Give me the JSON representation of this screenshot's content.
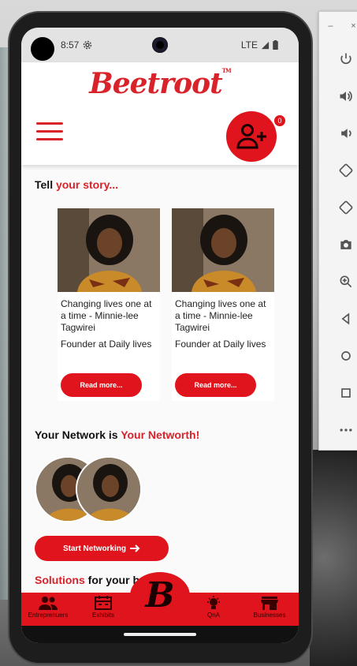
{
  "status_bar": {
    "time": "8:57",
    "network": "LTE"
  },
  "app": {
    "logo_text": "Beetroot",
    "trademark": "TM",
    "invite_badge_count": "0"
  },
  "story_section": {
    "title_plain": "Tell ",
    "title_accent": "your story...",
    "cards": [
      {
        "headline": "Changing lives one at a time - Minnie-lee Tagwirei",
        "role": "Founder at Daily lives",
        "button_label": "Read more..."
      },
      {
        "headline": "Changing lives one at a time - Minnie-lee Tagwirei",
        "role": "Founder at Daily lives",
        "button_label": "Read more..."
      }
    ]
  },
  "network_section": {
    "title_plain": "Your Network is ",
    "title_accent": "Your Networth!",
    "button_label": "Start Networking"
  },
  "solutions_section": {
    "title_accent": "Solutions",
    "title_plain": " for your b"
  },
  "bottom_nav": {
    "items": [
      {
        "label": "Entreprenuers",
        "icon": "people-icon"
      },
      {
        "label": "Exhibits",
        "icon": "calendar-icon"
      },
      {
        "label": "",
        "icon": "beetroot-b-logo"
      },
      {
        "label": "QnA",
        "icon": "lightbulb-icon"
      },
      {
        "label": "Businesses",
        "icon": "store-icon"
      }
    ]
  },
  "emulator_panel": {
    "buttons": [
      "power-icon",
      "volume-up-icon",
      "volume-down-icon",
      "rotate-left-icon",
      "rotate-right-icon",
      "camera-icon",
      "zoom-icon",
      "back-icon",
      "home-icon",
      "overview-icon",
      "more-icon"
    ]
  },
  "colors": {
    "brand_red": "#e0141c",
    "logo_red": "#d8232a"
  }
}
